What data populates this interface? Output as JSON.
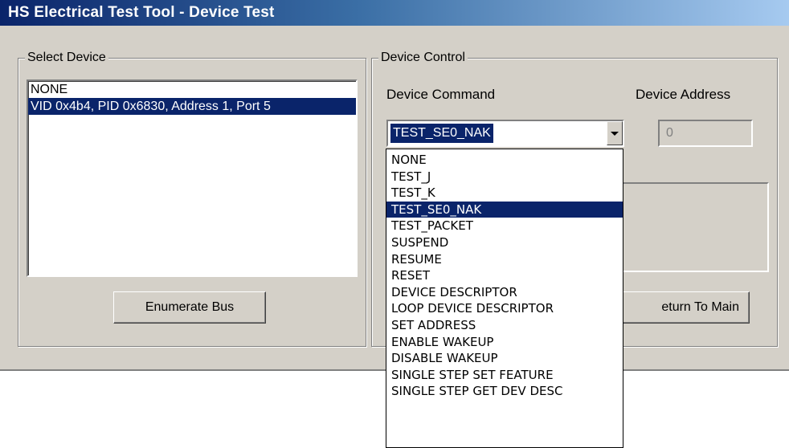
{
  "window": {
    "title": "HS Electrical Test Tool - Device Test"
  },
  "select_device": {
    "legend": "Select Device",
    "items": [
      {
        "label": "NONE",
        "selected": false
      },
      {
        "label": "VID 0x4b4, PID 0x6830, Address 1, Port 5",
        "selected": true
      }
    ],
    "enumerate_button": "Enumerate Bus"
  },
  "device_control": {
    "legend": "Device Control",
    "command_label": "Device Command",
    "address_label": "Device Address",
    "command_value": "TEST_SE0_NAK",
    "address_value": "0",
    "return_button": "Return To Main",
    "return_button_visible": "eturn To Main"
  },
  "dropdown": {
    "options": [
      "NONE",
      "TEST_J",
      "TEST_K",
      "TEST_SE0_NAK",
      "TEST_PACKET",
      "SUSPEND",
      "RESUME",
      "RESET",
      "DEVICE DESCRIPTOR",
      "LOOP DEVICE DESCRIPTOR",
      "SET ADDRESS",
      "ENABLE WAKEUP",
      "DISABLE WAKEUP",
      "SINGLE STEP SET FEATURE",
      "SINGLE STEP GET DEV DESC"
    ],
    "selected_index": 3
  },
  "colors": {
    "selection": "#0a246a",
    "face": "#d4d0c8"
  },
  "icons": {
    "dropdown_arrow": "chevron-down-icon"
  }
}
